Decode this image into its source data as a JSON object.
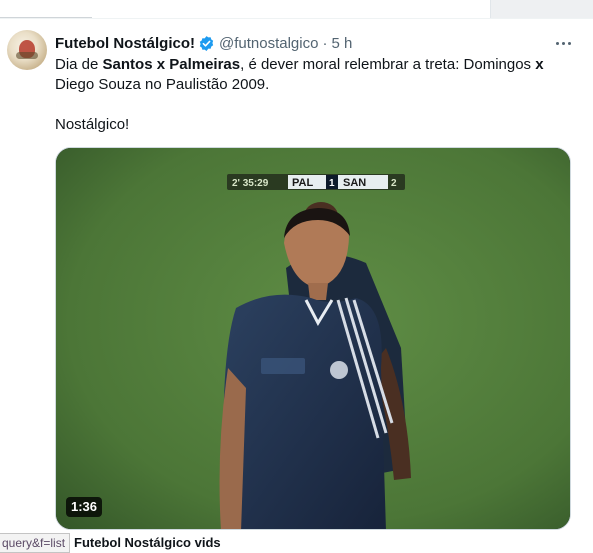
{
  "tweet": {
    "author_name": "Futebol Nostálgico!",
    "handle": "@futnostalgico",
    "separator": "·",
    "time": "5 h",
    "text": {
      "line1_prefix": "Dia de ",
      "line1_bold1": "Santos x Palmeiras",
      "line1_mid": ", é dever moral relembrar a treta: Domingos ",
      "line1_bold2": "x",
      "line2": "Diego Souza no Paulistão 2009.",
      "line3": "Nostálgico!"
    },
    "media": {
      "scoreboard": {
        "clock": "2' 35:29",
        "home": "PAL",
        "home_score": "1",
        "away": "SAN",
        "away_score": "2"
      },
      "duration": "1:36",
      "caption": "Futebol Nostálgico vids"
    }
  },
  "status_bar": {
    "url_fragment": "query&f=list"
  },
  "colors": {
    "verified": "#1d9bf0",
    "pitch": "#4e7a3a",
    "jersey": "#1f2f45",
    "text_primary": "#0f1419",
    "text_secondary": "#536471"
  },
  "icons": {
    "verified": "verified-badge-icon",
    "more": "more-options-icon"
  }
}
